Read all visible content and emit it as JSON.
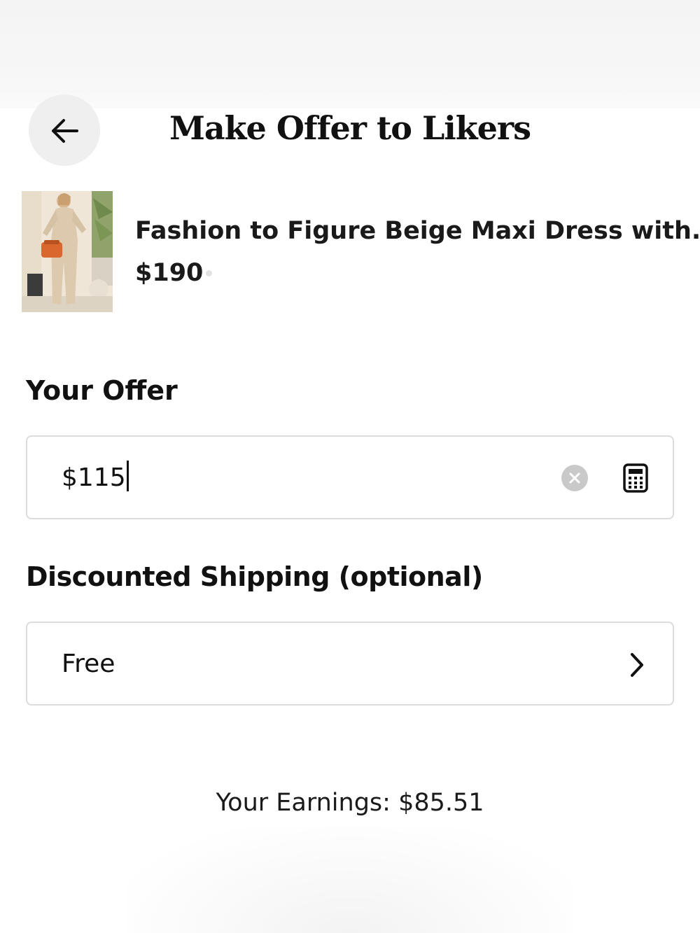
{
  "header": {
    "title": "Make Offer to Likers",
    "back_icon": "arrow-left-icon"
  },
  "product": {
    "title": "Fashion to Figure Beige Maxi Dress with...",
    "price": "$190",
    "thumbnail": "beige-maxi-dress-photo"
  },
  "offer": {
    "label": "Your Offer",
    "value": "$115",
    "clear_icon": "clear-circle-icon",
    "calculator_icon": "calculator-icon"
  },
  "shipping": {
    "label": "Discounted Shipping (optional)",
    "value": "Free",
    "chevron_icon": "chevron-right-icon"
  },
  "earnings": {
    "label": "Your Earnings: ",
    "amount": "$85.51"
  },
  "colors": {
    "text": "#111111",
    "field_border": "#dcdcdc",
    "back_button_bg": "#efefef",
    "clear_button_bg": "#c9c9c9"
  }
}
